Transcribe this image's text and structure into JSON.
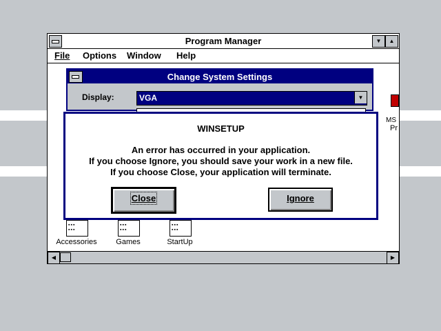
{
  "program_manager": {
    "title": "Program Manager",
    "menu": [
      "File",
      "Options",
      "Window",
      "Help"
    ],
    "groups": [
      "Accessories",
      "Games",
      "StartUp"
    ],
    "partial_icon_label": "Pr",
    "partial_icon_top": "MS"
  },
  "system_settings": {
    "title": "Change System Settings",
    "display_label": "Display:",
    "display_value": "VGA"
  },
  "error_dialog": {
    "title": "WINSETUP",
    "message_lines": [
      "An error has occurred in your application.",
      "If you choose Ignore, you should save your work in a new file.",
      "If you choose Close, your application will terminate."
    ],
    "close_label": "Close",
    "ignore_label": "Ignore"
  },
  "colors": {
    "desktop": "#c3c7cb",
    "active_caption": "#000080",
    "window": "#ffffff"
  }
}
